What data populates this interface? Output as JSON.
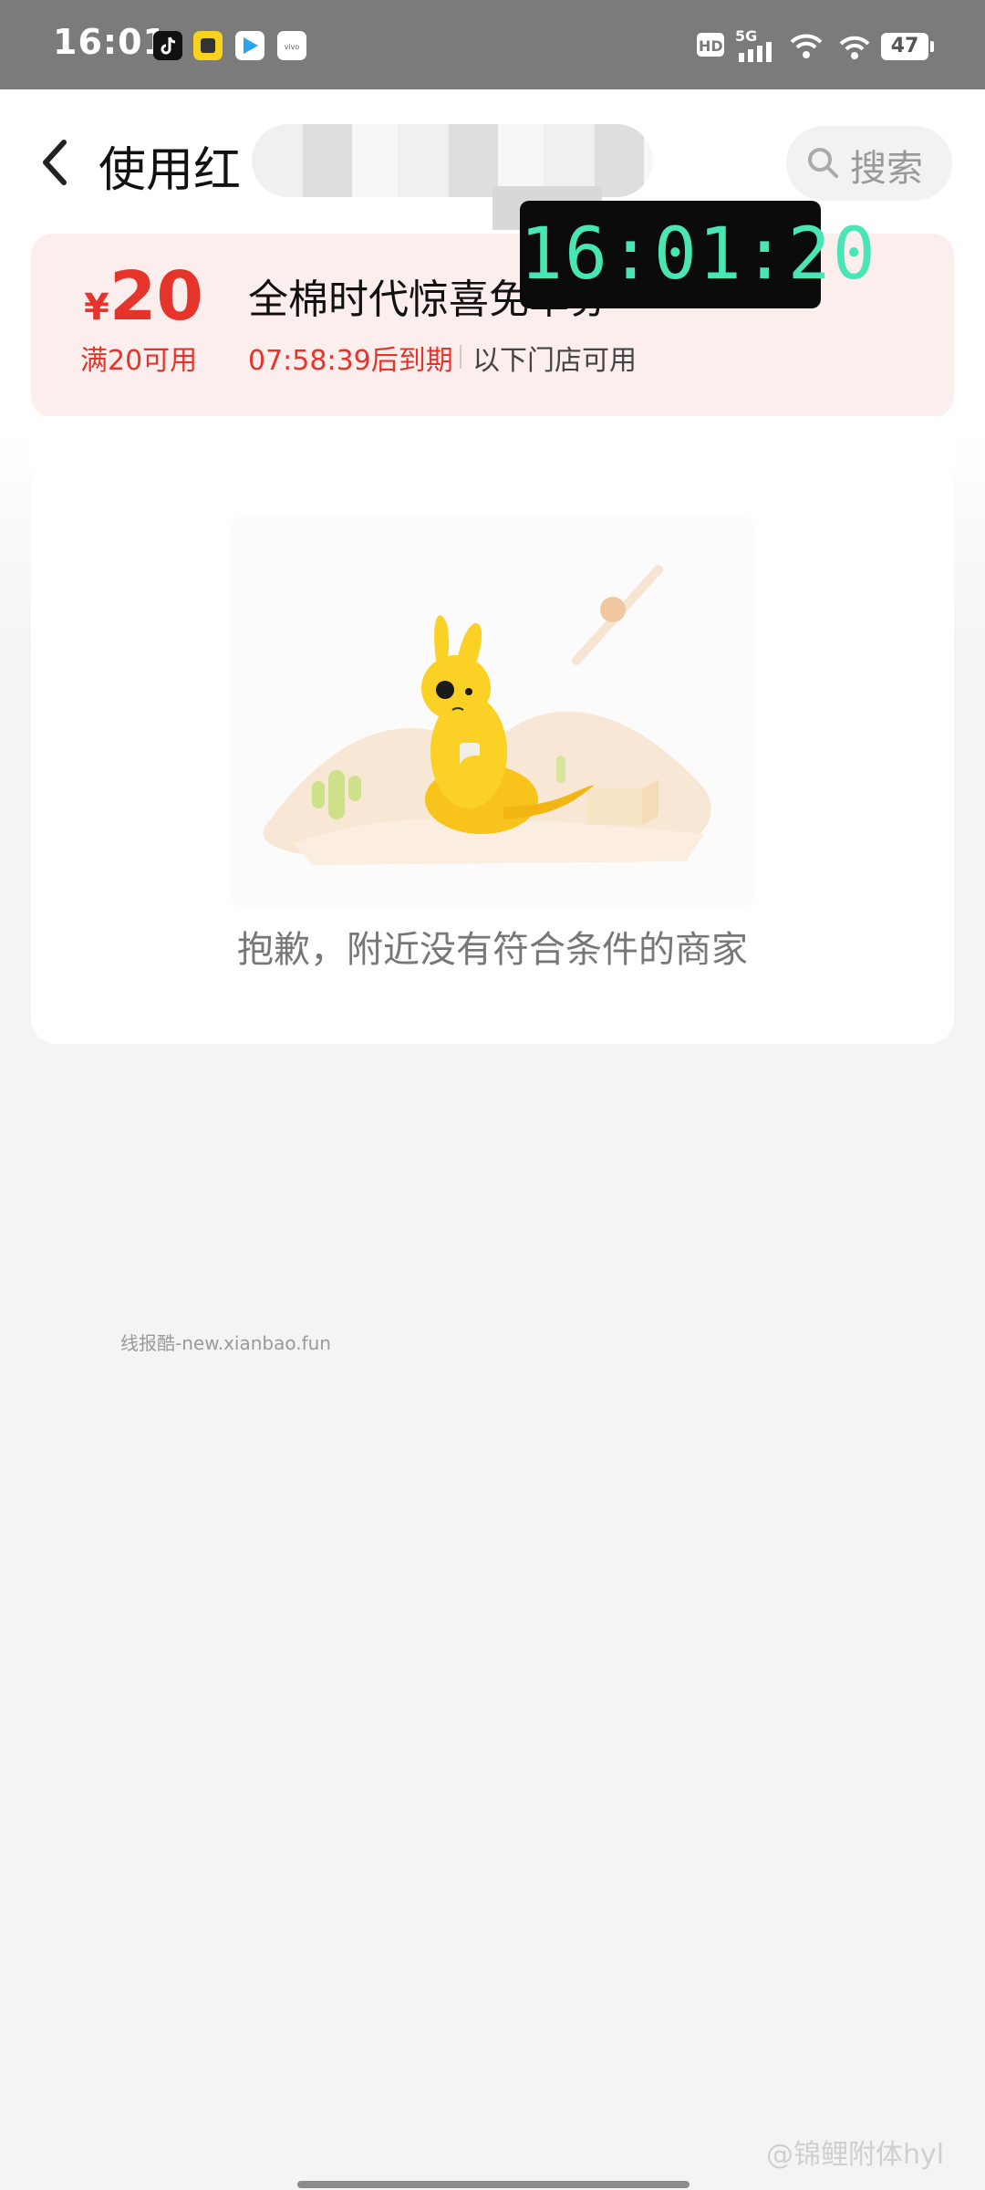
{
  "status_bar": {
    "time": "16:01",
    "app_icons": [
      "tiktok-icon",
      "yellow-app-icon",
      "blue-play-icon",
      "vivo-icon"
    ],
    "hd": "HD",
    "network": "5G",
    "battery": "47"
  },
  "header": {
    "title": "使用红",
    "search_label": "搜索"
  },
  "clock_overlay": "16:01:20",
  "coupon": {
    "currency": "¥",
    "amount": "20",
    "threshold": "满20可用",
    "title": "全棉时代惊喜免单券",
    "expiry": "07:58:39后到期",
    "note": "以下门店可用",
    "color": "#e5352a"
  },
  "empty_state": {
    "message": "抱歉，附近没有符合条件的商家"
  },
  "watermarks": {
    "site": "线报酷-new.xianbao.fun",
    "weibo": "@锦鲤附体hyl"
  }
}
